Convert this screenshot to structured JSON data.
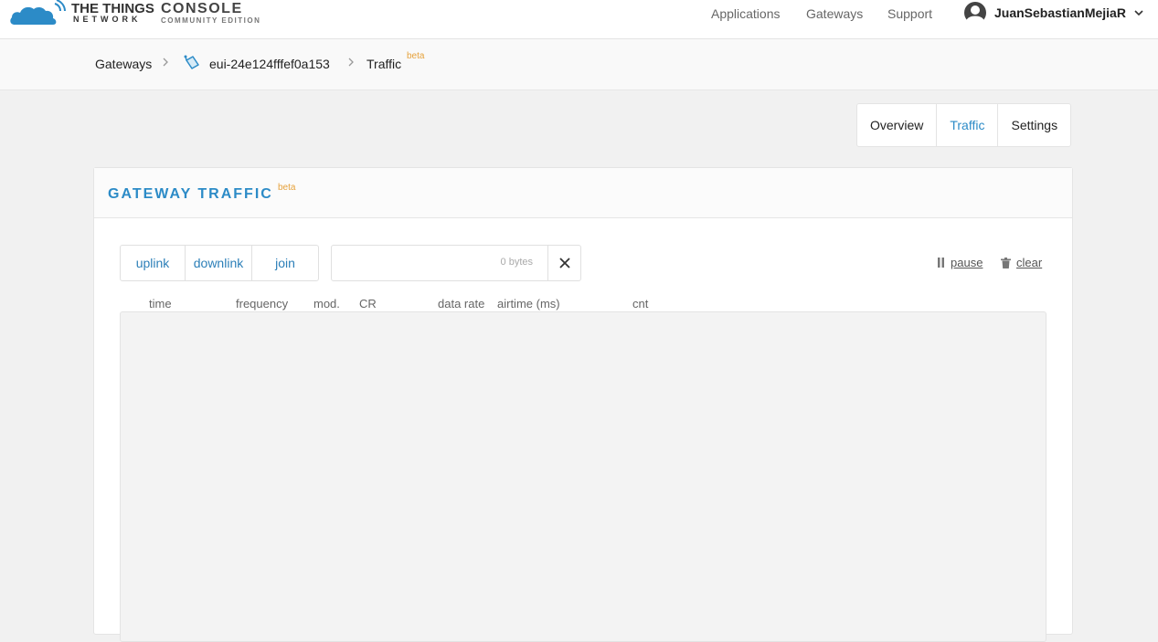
{
  "brand": {
    "name_main": "THE THINGS",
    "name_sub": "NETWORK",
    "console_main": "CONSOLE",
    "console_sub": "COMMUNITY EDITION"
  },
  "nav": {
    "applications": "Applications",
    "gateways": "Gateways",
    "support": "Support",
    "username": "JuanSebastianMejiaR"
  },
  "breadcrumb": {
    "gateways": "Gateways",
    "gateway_id": "eui-24e124fffef0a153",
    "current": "Traffic",
    "beta": "beta"
  },
  "tabs": {
    "overview": "Overview",
    "traffic": "Traffic",
    "settings": "Settings"
  },
  "card": {
    "title": "GATEWAY TRAFFIC",
    "beta": "beta",
    "filters": {
      "uplink": "uplink",
      "downlink": "downlink",
      "join": "join"
    },
    "search": {
      "placeholder": "0 bytes"
    },
    "actions": {
      "pause": "pause",
      "clear": "clear"
    },
    "columns": {
      "time": "time",
      "frequency": "frequency",
      "mod": "mod.",
      "cr": "CR",
      "data_rate": "data rate",
      "airtime": "airtime (ms)",
      "cnt": "cnt"
    }
  },
  "colors": {
    "accent": "#2c8bc7",
    "beta": "#e6a23c",
    "logo": "#2c8bc7"
  }
}
